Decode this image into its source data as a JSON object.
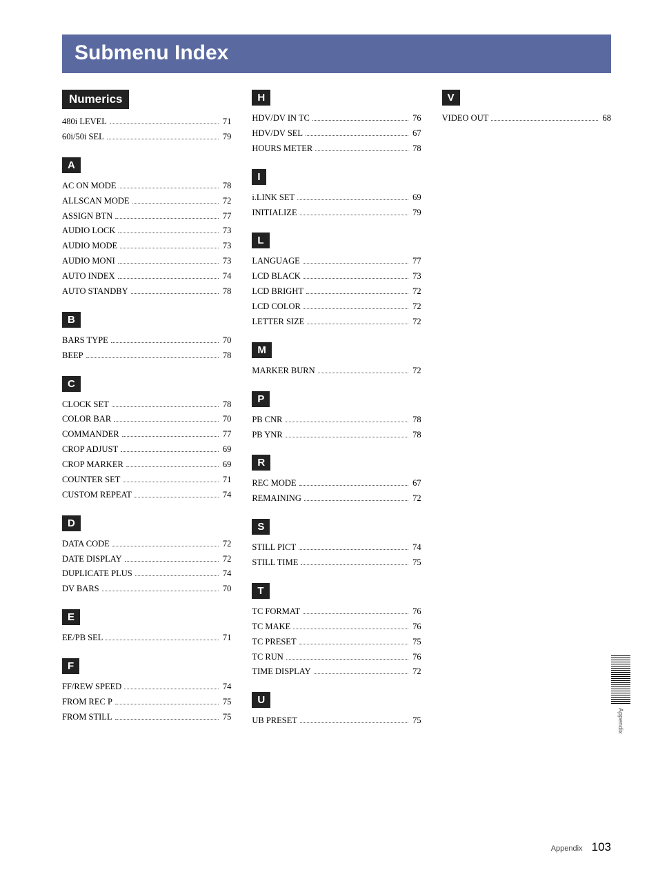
{
  "title": "Submenu Index",
  "footer": {
    "label": "Appendix",
    "page": "103"
  },
  "sideLabel": "Appendix",
  "sections": {
    "col1": [
      {
        "header": "Numerics",
        "big": true,
        "items": [
          {
            "label": "480i LEVEL",
            "page": "71"
          },
          {
            "label": "60i/50i SEL",
            "page": "79"
          }
        ]
      },
      {
        "header": "A",
        "items": [
          {
            "label": "AC ON MODE",
            "page": "78"
          },
          {
            "label": "ALLSCAN MODE",
            "page": "72"
          },
          {
            "label": "ASSIGN BTN",
            "page": "77"
          },
          {
            "label": "AUDIO LOCK",
            "page": "73"
          },
          {
            "label": "AUDIO MODE",
            "page": "73"
          },
          {
            "label": "AUDIO MONI",
            "page": "73"
          },
          {
            "label": "AUTO INDEX",
            "page": "74"
          },
          {
            "label": "AUTO STANDBY",
            "page": "78"
          }
        ]
      },
      {
        "header": "B",
        "items": [
          {
            "label": "BARS TYPE",
            "page": "70"
          },
          {
            "label": "BEEP",
            "page": "78"
          }
        ]
      },
      {
        "header": "C",
        "items": [
          {
            "label": "CLOCK SET",
            "page": "78"
          },
          {
            "label": "COLOR BAR",
            "page": "70"
          },
          {
            "label": "COMMANDER",
            "page": "77"
          },
          {
            "label": "CROP ADJUST",
            "page": "69"
          },
          {
            "label": "CROP MARKER",
            "page": "69"
          },
          {
            "label": "COUNTER SET",
            "page": "71"
          },
          {
            "label": "CUSTOM REPEAT",
            "page": "74"
          }
        ]
      },
      {
        "header": "D",
        "items": [
          {
            "label": "DATA CODE",
            "page": "72"
          },
          {
            "label": "DATE DISPLAY",
            "page": "72"
          },
          {
            "label": "DUPLICATE PLUS",
            "page": "74"
          },
          {
            "label": "DV BARS",
            "page": "70"
          }
        ]
      },
      {
        "header": "E",
        "items": [
          {
            "label": "EE/PB SEL",
            "page": "71"
          }
        ]
      },
      {
        "header": "F",
        "items": [
          {
            "label": "FF/REW SPEED",
            "page": "74"
          },
          {
            "label": "FROM REC P",
            "page": "75"
          },
          {
            "label": "FROM STILL",
            "page": "75"
          }
        ]
      }
    ],
    "col2": [
      {
        "header": "H",
        "items": [
          {
            "label": "HDV/DV IN TC",
            "page": "76"
          },
          {
            "label": "HDV/DV SEL",
            "page": "67"
          },
          {
            "label": "HOURS METER",
            "page": "78"
          }
        ]
      },
      {
        "header": "I",
        "items": [
          {
            "label": "i.LINK SET",
            "page": "69"
          },
          {
            "label": "INITIALIZE",
            "page": "79"
          }
        ]
      },
      {
        "header": "L",
        "items": [
          {
            "label": "LANGUAGE",
            "page": "77"
          },
          {
            "label": "LCD BLACK",
            "page": "73"
          },
          {
            "label": "LCD BRIGHT",
            "page": "72"
          },
          {
            "label": "LCD COLOR",
            "page": "72"
          },
          {
            "label": "LETTER SIZE",
            "page": "72"
          }
        ]
      },
      {
        "header": "M",
        "items": [
          {
            "label": "MARKER BURN",
            "page": "72"
          }
        ]
      },
      {
        "header": "P",
        "items": [
          {
            "label": "PB CNR",
            "page": "78"
          },
          {
            "label": "PB YNR",
            "page": "78"
          }
        ]
      },
      {
        "header": "R",
        "items": [
          {
            "label": "REC MODE",
            "page": "67"
          },
          {
            "label": "REMAINING",
            "page": "72"
          }
        ]
      },
      {
        "header": "S",
        "items": [
          {
            "label": "STILL PICT",
            "page": "74"
          },
          {
            "label": "STILL TIME",
            "page": "75"
          }
        ]
      },
      {
        "header": "T",
        "items": [
          {
            "label": "TC FORMAT",
            "page": "76"
          },
          {
            "label": "TC MAKE",
            "page": "76"
          },
          {
            "label": "TC PRESET",
            "page": "75"
          },
          {
            "label": "TC RUN",
            "page": "76"
          },
          {
            "label": "TIME DISPLAY",
            "page": "72"
          }
        ]
      },
      {
        "header": "U",
        "items": [
          {
            "label": "UB PRESET",
            "page": "75"
          }
        ]
      }
    ],
    "col3": [
      {
        "header": "V",
        "items": [
          {
            "label": "VIDEO OUT",
            "page": "68"
          }
        ]
      }
    ]
  }
}
